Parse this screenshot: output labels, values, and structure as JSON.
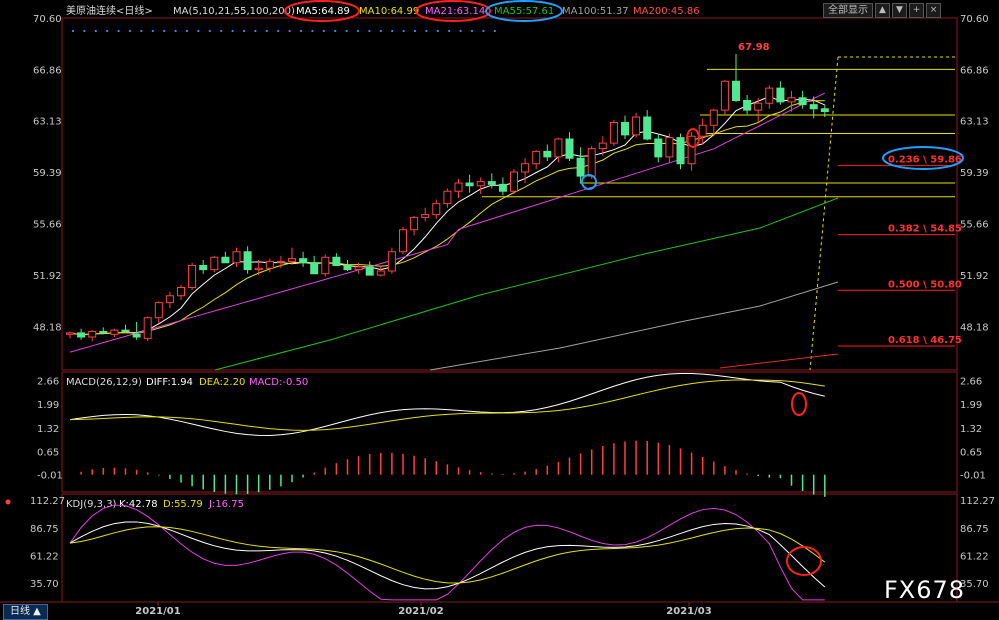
{
  "header": {
    "symbol": "美原油连续<日线>",
    "ma_params": "MA(5,10,21,55,100,200)",
    "ma5": "MA5:64.89",
    "ma10": "MA10:64.99",
    "ma21": "MA21:63.14",
    "ma55": "MA55:57.61",
    "ma100": "MA100:51.37",
    "ma200": "MA200:45.86"
  },
  "toolbar": {
    "screen_label": "全部显示",
    "icons": [
      "up-icon",
      "down-icon",
      "plus-icon",
      "close-icon"
    ]
  },
  "watermark": "FX678",
  "period_tab": "日线 ▲",
  "colors": {
    "up": "#ff4040",
    "down": "#50e890",
    "ma5": "#ffffff",
    "ma10": "#e8e000",
    "ma21": "#e040e0",
    "ma55": "#20c020",
    "ma100": "#a0a0a0",
    "ma200": "#e03020",
    "fib": "#e8e000",
    "annot_red": "#ff2020",
    "annot_blue": "#20a0ff"
  },
  "chart_data": {
    "type": "candlestick",
    "x_labels": [
      "2021/01",
      "2021/02",
      "2021/03"
    ],
    "price_axis": {
      "ticks": [
        "70.60",
        "66.86",
        "63.13",
        "59.39",
        "55.66",
        "51.92",
        "48.18"
      ],
      "ylim": [
        45.0,
        70.6
      ]
    },
    "high_label": "67.98",
    "fib_labels": [
      {
        "text": "0.236 \\ 59.86",
        "price": 59.86
      },
      {
        "text": "0.382 \\ 54.85",
        "price": 54.85
      },
      {
        "text": "0.500 \\ 50.80",
        "price": 50.8
      },
      {
        "text": "0.618 \\ 46.75",
        "price": 46.75
      }
    ],
    "candles": [
      [
        47.6,
        47.8,
        47.3,
        47.7
      ],
      [
        47.7,
        48.0,
        47.2,
        47.4
      ],
      [
        47.4,
        47.9,
        47.1,
        47.8
      ],
      [
        47.8,
        48.1,
        47.6,
        47.7
      ],
      [
        47.6,
        48.0,
        47.4,
        47.9
      ],
      [
        47.9,
        48.3,
        47.7,
        47.8
      ],
      [
        47.6,
        48.5,
        47.2,
        47.4
      ],
      [
        47.3,
        48.9,
        47.1,
        48.8
      ],
      [
        48.8,
        50.0,
        48.4,
        49.9
      ],
      [
        49.9,
        50.7,
        49.5,
        50.4
      ],
      [
        50.4,
        51.2,
        50.1,
        51.0
      ],
      [
        51.0,
        52.8,
        50.8,
        52.6
      ],
      [
        52.6,
        53.0,
        52.0,
        52.3
      ],
      [
        52.3,
        53.3,
        52.1,
        53.2
      ],
      [
        53.2,
        53.6,
        52.8,
        52.8
      ],
      [
        52.8,
        53.9,
        52.5,
        53.6
      ],
      [
        53.6,
        54.0,
        52.0,
        52.3
      ],
      [
        52.3,
        53.0,
        51.9,
        52.4
      ],
      [
        52.4,
        53.1,
        52.1,
        52.9
      ],
      [
        52.9,
        53.3,
        52.4,
        52.9
      ],
      [
        52.9,
        53.9,
        52.7,
        53.1
      ],
      [
        53.1,
        53.6,
        52.5,
        52.8
      ],
      [
        52.8,
        53.3,
        52.2,
        52.0
      ],
      [
        52.0,
        53.4,
        51.8,
        53.2
      ],
      [
        53.2,
        53.5,
        52.6,
        52.6
      ],
      [
        52.6,
        53.0,
        52.2,
        52.3
      ],
      [
        52.3,
        52.8,
        52.0,
        52.5
      ],
      [
        52.5,
        52.9,
        51.9,
        51.9
      ],
      [
        51.9,
        52.5,
        51.8,
        52.2
      ],
      [
        52.2,
        53.9,
        52.0,
        53.6
      ],
      [
        53.6,
        55.4,
        53.4,
        55.2
      ],
      [
        55.2,
        56.2,
        54.8,
        56.1
      ],
      [
        56.1,
        56.8,
        55.8,
        56.3
      ],
      [
        56.3,
        57.4,
        56.0,
        57.1
      ],
      [
        57.1,
        58.2,
        56.8,
        58.0
      ],
      [
        58.0,
        58.9,
        57.5,
        58.6
      ],
      [
        58.6,
        59.2,
        57.9,
        58.4
      ],
      [
        58.4,
        59.0,
        57.8,
        58.7
      ],
      [
        58.7,
        59.3,
        58.2,
        58.5
      ],
      [
        58.5,
        59.0,
        57.7,
        58.0
      ],
      [
        58.0,
        59.6,
        57.8,
        59.4
      ],
      [
        59.4,
        60.4,
        58.6,
        60.0
      ],
      [
        60.0,
        61.0,
        59.6,
        60.9
      ],
      [
        60.9,
        61.4,
        60.2,
        60.5
      ],
      [
        60.5,
        61.9,
        60.1,
        61.8
      ],
      [
        61.8,
        62.3,
        60.2,
        60.4
      ],
      [
        60.4,
        61.2,
        58.6,
        59.1
      ],
      [
        59.1,
        61.3,
        58.9,
        61.1
      ],
      [
        61.1,
        62.0,
        60.6,
        61.5
      ],
      [
        61.5,
        63.2,
        61.3,
        63.0
      ],
      [
        63.0,
        63.5,
        61.8,
        62.1
      ],
      [
        62.1,
        63.7,
        61.9,
        63.4
      ],
      [
        63.4,
        63.9,
        61.7,
        61.8
      ],
      [
        61.8,
        62.2,
        60.1,
        60.5
      ],
      [
        60.5,
        62.2,
        60.1,
        61.9
      ],
      [
        61.9,
        62.2,
        59.6,
        60.0
      ],
      [
        60.0,
        62.3,
        59.5,
        62.0
      ],
      [
        62.0,
        63.3,
        61.4,
        62.8
      ],
      [
        62.8,
        64.0,
        62.0,
        63.9
      ],
      [
        63.9,
        66.1,
        63.6,
        66.0
      ],
      [
        66.0,
        67.98,
        64.5,
        64.6
      ],
      [
        64.6,
        65.0,
        63.6,
        63.9
      ],
      [
        63.9,
        64.8,
        63.0,
        64.4
      ],
      [
        64.4,
        65.7,
        64.0,
        65.5
      ],
      [
        65.5,
        66.0,
        64.3,
        64.5
      ],
      [
        64.5,
        65.3,
        63.8,
        64.8
      ],
      [
        64.8,
        65.3,
        64.0,
        64.3
      ],
      [
        64.3,
        64.9,
        63.3,
        64.0
      ],
      [
        64.0,
        64.3,
        63.4,
        63.8
      ]
    ],
    "macd": {
      "label": "MACD(26,12,9)",
      "diff": "DIFF:1.94",
      "dea": "DEA:2.20",
      "macd": "MACD:-0.50",
      "ticks": [
        "2.66",
        "1.99",
        "1.32",
        "0.65",
        "-0.01"
      ],
      "ylim": [
        -0.5,
        2.9
      ]
    },
    "kdj": {
      "label": "KDJ(9,3,3)",
      "k": "K:42.78",
      "d": "D:55.79",
      "j": "J:16.75",
      "ticks": [
        "112.27",
        "86.75",
        "61.22",
        "35.70"
      ],
      "ylim": [
        18,
        118
      ]
    }
  }
}
